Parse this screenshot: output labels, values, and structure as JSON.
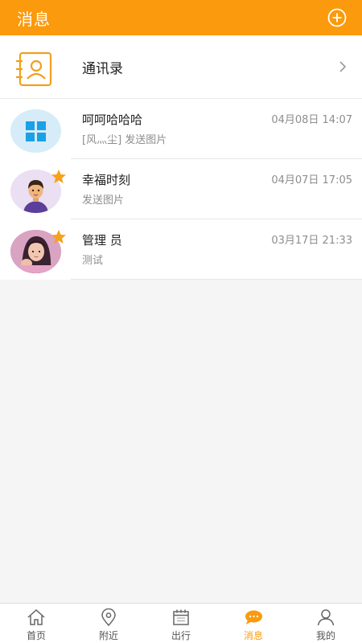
{
  "header": {
    "title": "消息"
  },
  "contacts": {
    "label": "通讯录"
  },
  "messages": [
    {
      "name": "呵呵哈哈哈",
      "time": "04月08日 14:07",
      "preview": "[风灬尘] 发送图片",
      "avatar": "windows-logo-avatar",
      "starred": false
    },
    {
      "name": "幸福时刻",
      "time": "04月07日 17:05",
      "preview": "发送图片",
      "avatar": "cartoon-man-avatar",
      "starred": true
    },
    {
      "name": "管理 员",
      "time": "03月17日 21:33",
      "preview": "测试",
      "avatar": "photo-girl-avatar",
      "starred": true
    }
  ],
  "tabs": [
    {
      "label": "首页",
      "icon": "home-icon",
      "active": false
    },
    {
      "label": "附近",
      "icon": "location-pin-icon",
      "active": false
    },
    {
      "label": "出行",
      "icon": "calendar-icon",
      "active": false
    },
    {
      "label": "消息",
      "icon": "chat-bubble-icon",
      "active": true
    },
    {
      "label": "我的",
      "icon": "user-icon",
      "active": false
    }
  ],
  "colors": {
    "accent": "#fb9a0c",
    "background": "#f5f5f5",
    "secondary_text": "#8d8d8d"
  }
}
